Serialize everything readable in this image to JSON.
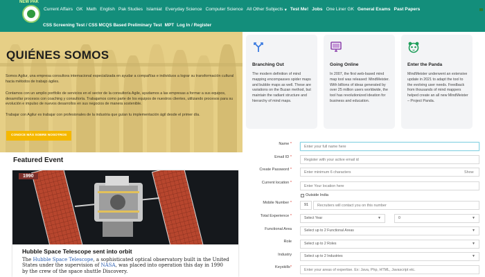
{
  "nav": {
    "logo_text": "NEW PAK",
    "row1": [
      {
        "label": "Current Affairs",
        "bold": false
      },
      {
        "label": "GK",
        "bold": false
      },
      {
        "label": "Math",
        "bold": false
      },
      {
        "label": "English",
        "bold": false
      },
      {
        "label": "Pak Studies",
        "bold": false
      },
      {
        "label": "Islamiat",
        "bold": false
      },
      {
        "label": "Everyday Science",
        "bold": false
      },
      {
        "label": "Computer Science",
        "bold": false
      },
      {
        "label": "All Other Subjects",
        "bold": false
      },
      {
        "label": "Test Me!",
        "bold": true
      },
      {
        "label": "Jobs",
        "bold": true
      },
      {
        "label": "One Liner GK",
        "bold": false
      },
      {
        "label": "General Exams",
        "bold": true
      },
      {
        "label": "Past Papers",
        "bold": true
      }
    ],
    "all_subjects_chevron": "▾",
    "row2": [
      "CSS Screening Test / CSS MCQS Based Preliminary Test",
      "MPT",
      "Log In / Register"
    ]
  },
  "hero": {
    "title": "QUIÉNES SOMOS",
    "p1": "Somos Agilur, una empresa consultora internacional especializada en ayudar a compañías e individuos a lograr su transformación cultural hacia métodos de trabajo ágiles.",
    "p2": "Contamos con un amplio portfolio de servicios en el sector de la consultoría Agile, ayudamos a las empresas a formar a sus equipos, desarrollar procesos con coaching y consultoría. Trabajamos como parte de los equipos de nuestros clientes, utilizando procesos para su evolución e impulso de nuevos desarrollos en sus negocios de manera sostenible.",
    "p3": "Trabajar con Agilur es trabajar con profesionales de la industria que guían tu implementación ágil desde el primer día.",
    "button": "CONOCE MÁS SOBRE NOSOTROS"
  },
  "featured": {
    "section_title": "Featured Event",
    "year": "1990",
    "headline": "Hubble Space Telescope sent into orbit",
    "body_pre": "The ",
    "body_link1": "Hubble Space Telescope",
    "body_mid": ", a sophisticated optical observatory built in the United States under the supervision of ",
    "body_link2": "NASA",
    "body_post": ", was placed into operation this day in 1990 by the crew of the space shuttle Discovery."
  },
  "cards": [
    {
      "title": "Branching Out",
      "icon": "branch-arrows-icon",
      "color": "#3b7be0",
      "body": "The modern definition of mind mapping encompasses spider maps and bubble maps as well. These are variations on the Buzan method, but maintain the radiant structure and hierarchy of mind maps."
    },
    {
      "title": "Going Online",
      "icon": "monitor-icon",
      "color": "#8e44ad",
      "body": "In 2007, the first web-based mind map tool was released: MindMeister. With billions of ideas generated by over 25 million users worldwide, the tool has revolutionized ideation for business and education."
    },
    {
      "title": "Enter the Panda",
      "icon": "panda-icon",
      "color": "#1e9e5a",
      "body": "MindMeister underwent an extensive update in 2021 to adapt the tool to the evolving user needs. Feedback from thousands of mind mappers helped create an all new MindMeister – Project Panda."
    }
  ],
  "form": {
    "name_label": "Name",
    "name_placeholder": "Enter your full name here",
    "email_label": "Email ID",
    "email_placeholder": "Register with your active email id",
    "password_label": "Create Password",
    "password_placeholder": "Enter minimum 6 characters",
    "show_label": "Show",
    "location_label": "Current location",
    "location_placeholder": "Enter Your location here",
    "outside_india": "Outside India",
    "mobile_label": "Mobile Number",
    "country_code": "91",
    "mobile_placeholder": "Recruiters will contact you on this number",
    "experience_label": "Total Experience",
    "experience_year": "Select Year",
    "experience_month": "0",
    "functional_label": "Functional Area",
    "functional_value": "Select up to 2 Functional Areas",
    "role_label": "Role",
    "role_value": "Select up to 2 Roles",
    "industry_label": "Industry",
    "industry_value": "Select up to 2 Industries",
    "keyskills_label": "Keyskills",
    "keyskills_placeholder": "Enter your areas of expertise. Ex: Java, Php, HTML, Javascript etc.",
    "required_mark": "*"
  },
  "colors": {
    "nav_bg": "#138e7b",
    "hero_bg": "#e6cf86",
    "hero_button": "#f5b800",
    "year_badge": "#7a2f2a",
    "link": "#2a5db0"
  }
}
